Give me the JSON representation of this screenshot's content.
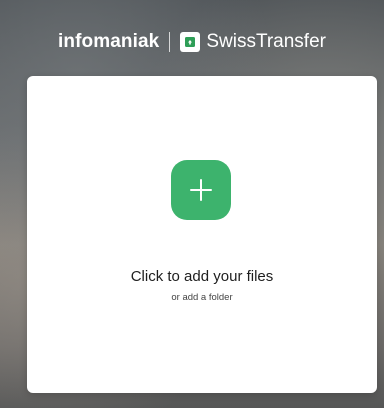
{
  "header": {
    "brand": "infomaniak",
    "app_name": "SwissTransfer"
  },
  "upload": {
    "main_label": "Click to add your files",
    "folder_label": "or add a folder"
  },
  "colors": {
    "accent_green": "#3db36d",
    "logo_green": "#2e9e57",
    "text_dark": "#1e1e1e"
  },
  "icons": {
    "add": "plus-icon",
    "logo": "swisstransfer-logo-icon"
  }
}
